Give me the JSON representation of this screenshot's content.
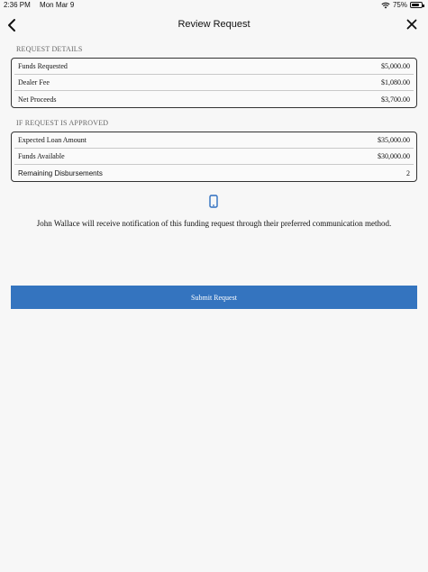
{
  "status_bar": {
    "time": "2:36 PM",
    "date": "Mon Mar 9",
    "battery": "75%"
  },
  "nav": {
    "title": "Review Request"
  },
  "request_details": {
    "header": "REQUEST DETAILS",
    "rows": [
      {
        "label": "Funds Requested",
        "value": "$5,000.00"
      },
      {
        "label": "Dealer Fee",
        "value": "$1,080.00"
      },
      {
        "label": "Net Proceeds",
        "value": "$3,700.00"
      }
    ]
  },
  "if_approved": {
    "header": "IF REQUEST IS APPROVED",
    "rows": [
      {
        "label": "Expected Loan Amount",
        "value": "$35,000.00"
      },
      {
        "label": "Funds Available",
        "value": "$30,000.00"
      },
      {
        "label": "Remaining Disbursements",
        "value": "2"
      }
    ]
  },
  "notice": {
    "text": "John Wallace will receive notification of this funding request through their preferred communication method."
  },
  "actions": {
    "submit_label": "Submit Request"
  },
  "colors": {
    "accent": "#3474bf",
    "icon": "#2f6fc0"
  }
}
